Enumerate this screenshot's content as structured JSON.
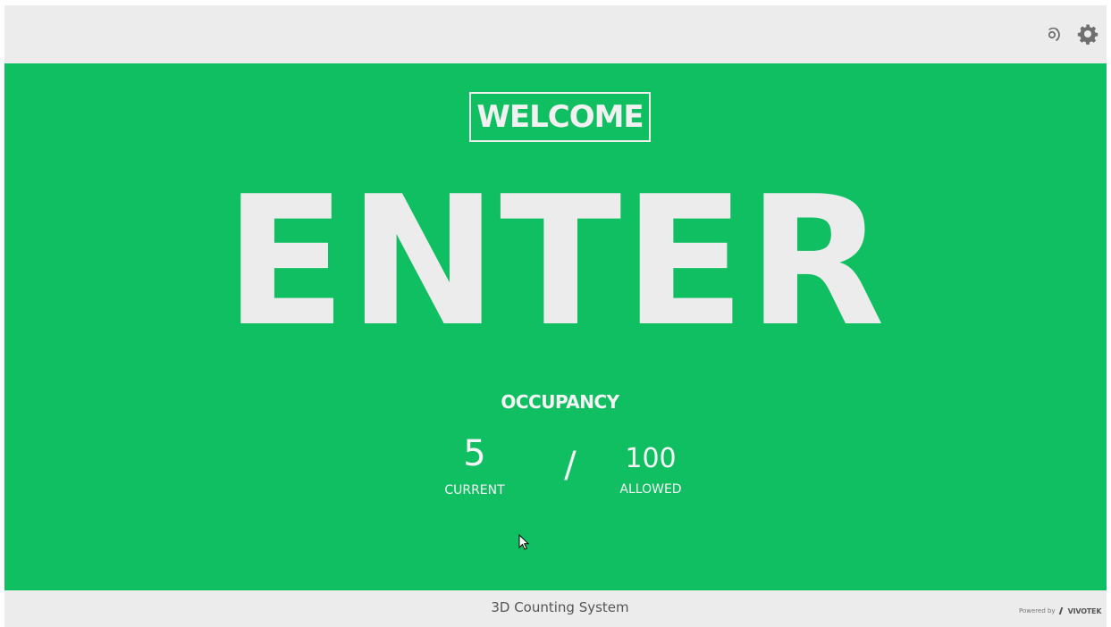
{
  "app": {
    "title": "3D Counting System"
  },
  "topbar": {
    "icons": [
      "sound-icon",
      "gear-icon"
    ]
  },
  "status": {
    "greeting": "WELCOME",
    "state": "ENTER",
    "state_color": "#11BF63"
  },
  "occupancy": {
    "label": "OCCUPANCY",
    "current": "5",
    "current_label": "CURRENT",
    "separator": "/",
    "allowed": "100",
    "allowed_label": "ALLOWED"
  },
  "footer": {
    "system_name": "3D Counting System",
    "powered_by": "Powered by",
    "brand": "VIVOTEK"
  },
  "colors": {
    "background": "#ECECEC",
    "text_light": "#F1F1F1",
    "icon_gray": "#6F6F6F"
  }
}
